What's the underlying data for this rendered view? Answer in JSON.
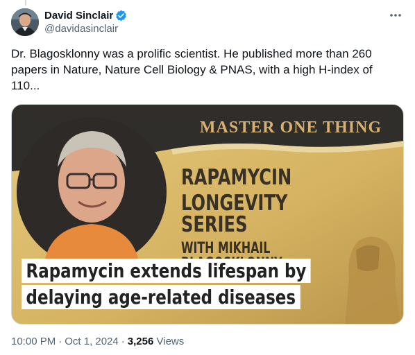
{
  "author": {
    "display_name": "David Sinclair",
    "handle": "@davidasinclair",
    "verified_color": "#1d9bf0"
  },
  "tweet": {
    "text": "Dr. Blagosklonny was a prolific scientist. He published more than 260 papers in Nature, Nature Cell Biology & PNAS, with a high H-index of 110..."
  },
  "media": {
    "banner": "MASTER ONE THING",
    "series_line1": "RAPAMYCIN",
    "series_line2": "LONGEVITY SERIES",
    "series_line3": "WITH MIKHAIL BLAGOSKLONNY",
    "caption_line1": "Rapamycin extends lifespan by",
    "caption_line2": "delaying age-related diseases"
  },
  "meta": {
    "time": "10:00 PM",
    "date": "Oct 1, 2024",
    "views_count": "3,256",
    "views_label": "Views"
  },
  "icons": {
    "more": "more-options-icon",
    "verified": "verified-badge-icon"
  },
  "colors": {
    "text_primary": "#0f1419",
    "text_secondary": "#536471",
    "verified_blue": "#1d9bf0",
    "banner_gold": "#d8b070"
  }
}
